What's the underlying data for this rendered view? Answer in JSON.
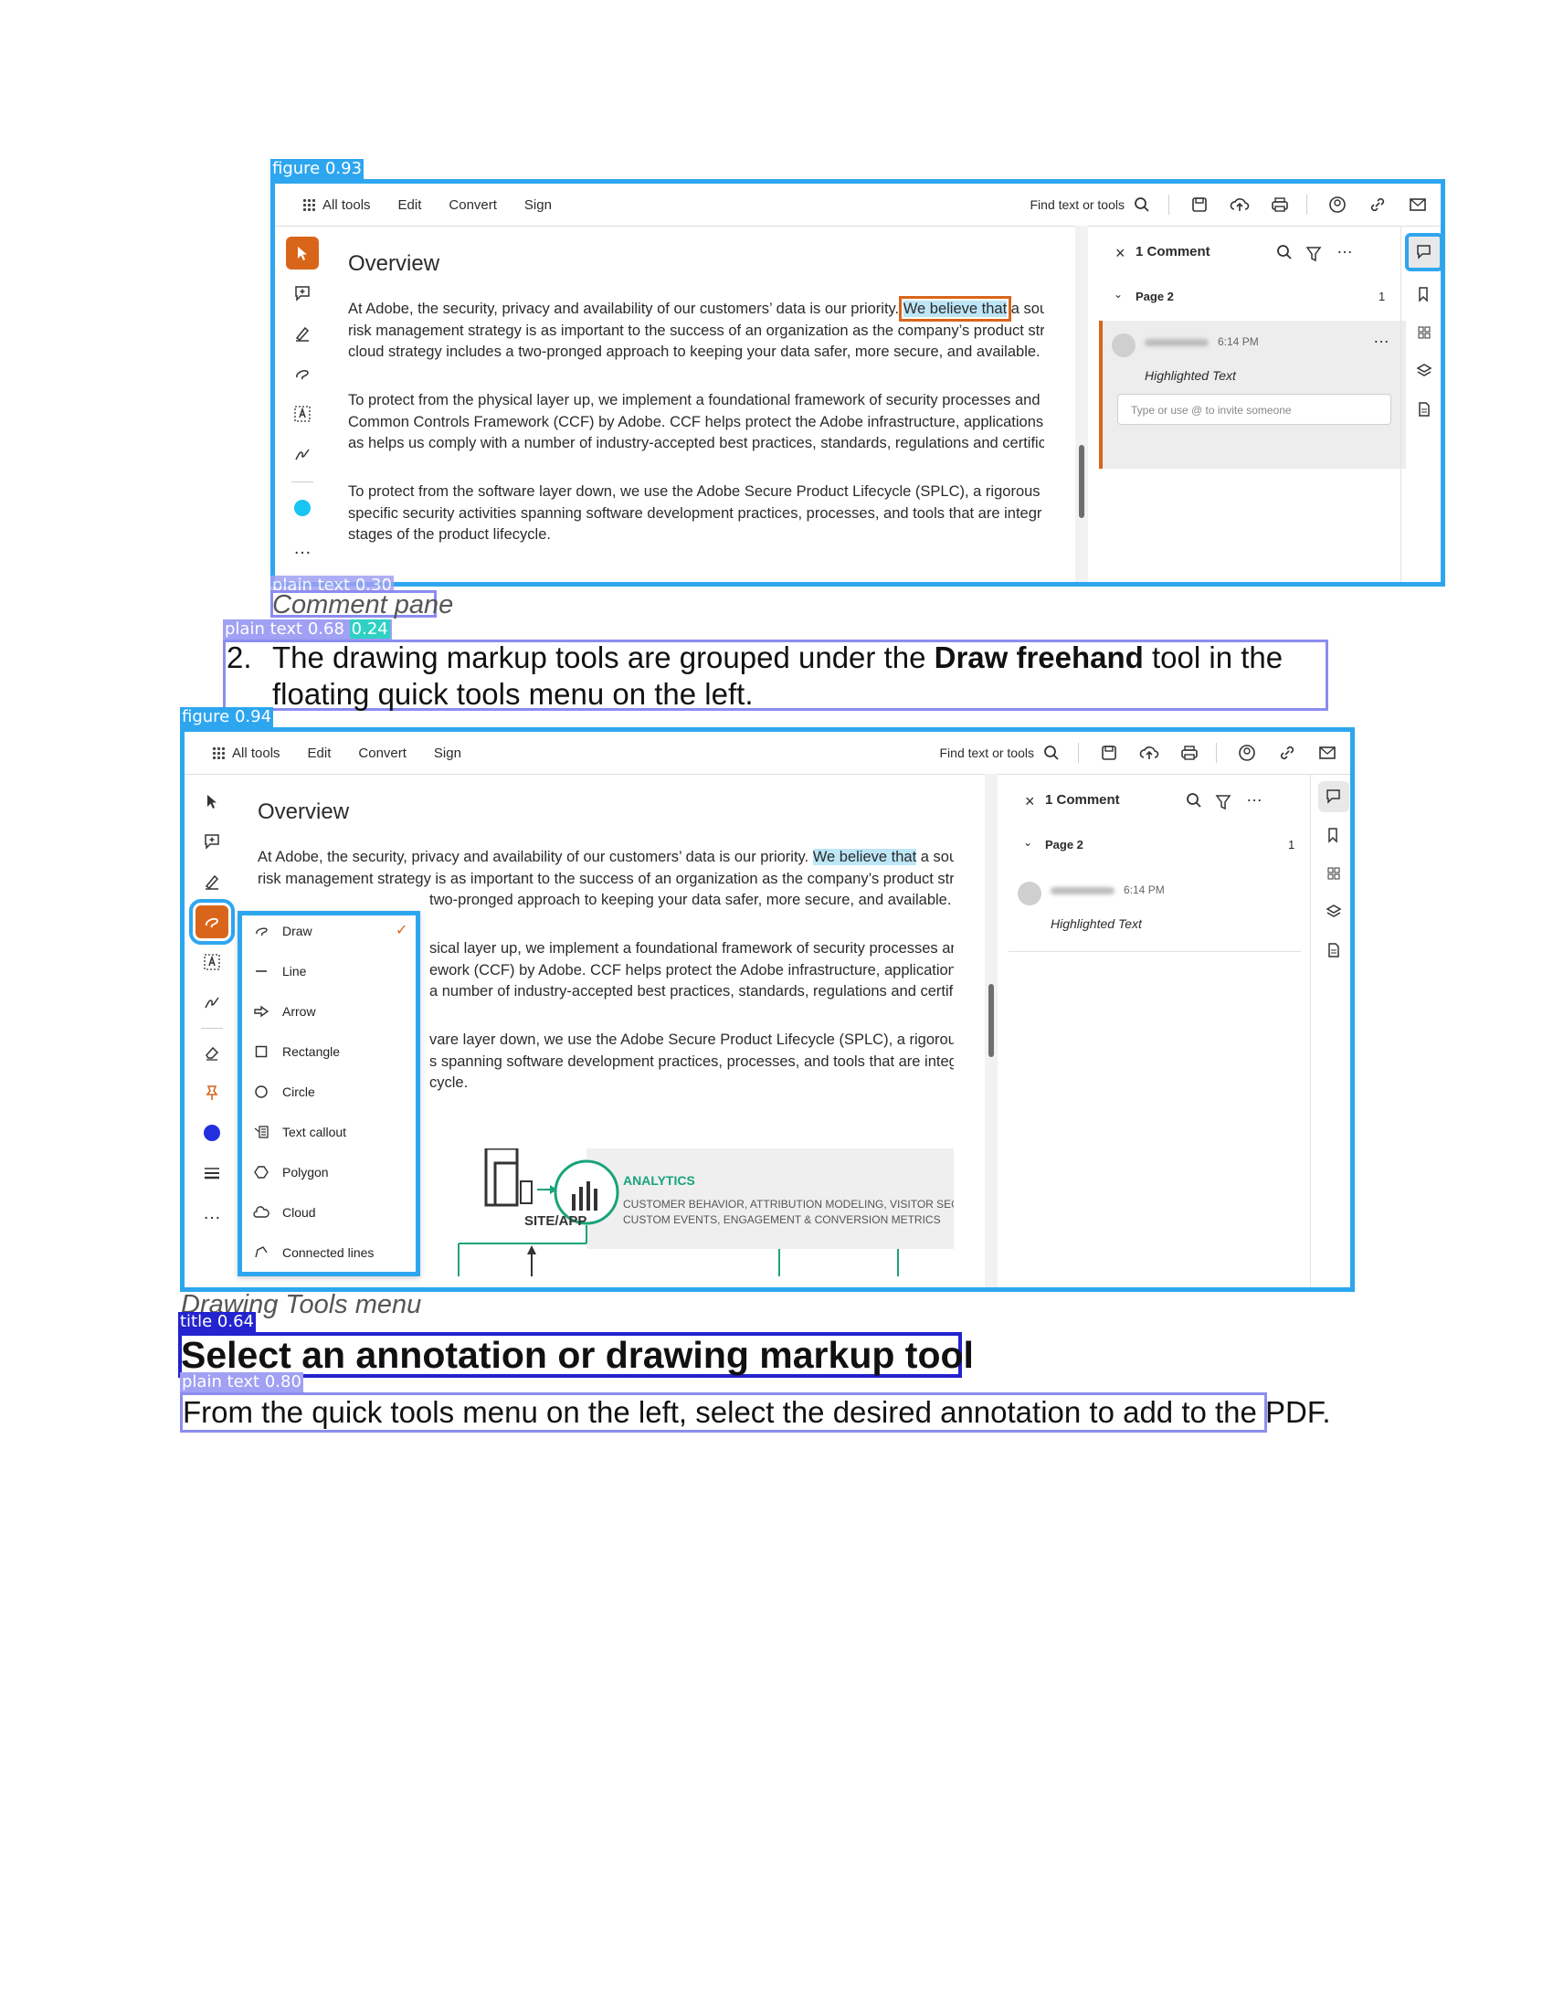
{
  "detections": {
    "figure1": "figure 0.93",
    "plain_text1": "plain text 0.30",
    "plain_text2": "plain text 0.68",
    "plain_text2_extra": "0.24",
    "figure2": "figure 0.94",
    "title": "title 0.64",
    "plain_text3": "plain text 0.80"
  },
  "fig1": {
    "menu": [
      "All tools",
      "Edit",
      "Convert",
      "Sign"
    ],
    "find_label": "Find text or tools",
    "doc_heading": "Overview",
    "para1": [
      [
        "At Adobe, the security, privacy and availability of our customers’ data is our priority.",
        "We believe that",
        "a sour"
      ],
      "risk management strategy is as important to the success of an organization as the company’s product strate",
      "cloud strategy includes a two-pronged approach to keeping your data safer, more secure, and available."
    ],
    "para2": [
      "To protect from the physical layer up, we implement a foundational framework of security processes and",
      "Common Controls Framework (CCF) by Adobe. CCF helps protect the Adobe infrastructure, applications ar",
      "as helps us comply with a number of industry-accepted best practices, standards, regulations and certificati"
    ],
    "para3": [
      "To protect from the software layer down, we use the Adobe Secure Product Lifecycle (SPLC), a rigorous set",
      "specific security activities spanning software development practices, processes, and tools that are integr",
      "stages of the product lifecycle."
    ],
    "comment_count": "1 Comment",
    "page_label": "Page 2",
    "page_count": "1",
    "comment_time": "6:14 PM",
    "comment_type": "Highlighted Text",
    "reply_placeholder": "Type or use @ to invite someone",
    "more": "…"
  },
  "caption1": "Comment pane",
  "step": {
    "number": "2.",
    "pre": "The drawing markup tools are grouped under the ",
    "bold": "Draw freehand",
    "post": " tool in the floating quick tools menu on the left."
  },
  "fig2": {
    "menu": [
      "All tools",
      "Edit",
      "Convert",
      "Sign"
    ],
    "find_label": "Find text or tools",
    "doc_heading": "Overview",
    "para1": [
      [
        "At Adobe, the security, privacy and availability of our customers’ data is our priority.",
        "We believe that",
        "a sour"
      ],
      "risk management strategy is as important to the success of an organization as the company’s product strate",
      "two-pronged approach to keeping your data safer, more secure, and available."
    ],
    "para2": [
      "sical layer up, we implement a foundational framework of security processes and",
      "ework (CCF) by Adobe. CCF helps protect the Adobe infrastructure, applications ar",
      "a number of industry-accepted best practices, standards, regulations and certificati"
    ],
    "para3": [
      "vare layer down, we use the Adobe Secure Product Lifecycle (SPLC), a rigorous set",
      "s spanning software development practices, processes, and tools that are integr",
      "cycle."
    ],
    "dropdown": [
      "Draw",
      "Line",
      "Arrow",
      "Rectangle",
      "Circle",
      "Text callout",
      "Polygon",
      "Cloud",
      "Connected lines"
    ],
    "check": "✓",
    "analytics_title": "ANALYTICS",
    "analytics_line1": "CUSTOMER BEHAVIOR, ATTRIBUTION MODELING, VISITOR SEGMEI",
    "analytics_line2": "CUSTOM EVENTS, ENGAGEMENT & CONVERSION METRICS",
    "site_app": "SITE/APP",
    "comment_count": "1 Comment",
    "page_label": "Page 2",
    "page_count": "1",
    "comment_time": "6:14 PM",
    "comment_type": "Highlighted Text",
    "more": "…"
  },
  "caption2": "Drawing Tools menu",
  "heading": "Select an annotation or drawing markup tool",
  "body": "From the quick tools menu on the left, select the desired annotation to add to the PDF.",
  "colors": {
    "figure_box": "#2ea6ef",
    "text_box": "#8c8cf0",
    "title_box": "#2323cf",
    "accent_orange": "#d9651b",
    "highlight": "#bde6f7",
    "analytics_green": "#1aa37a"
  }
}
